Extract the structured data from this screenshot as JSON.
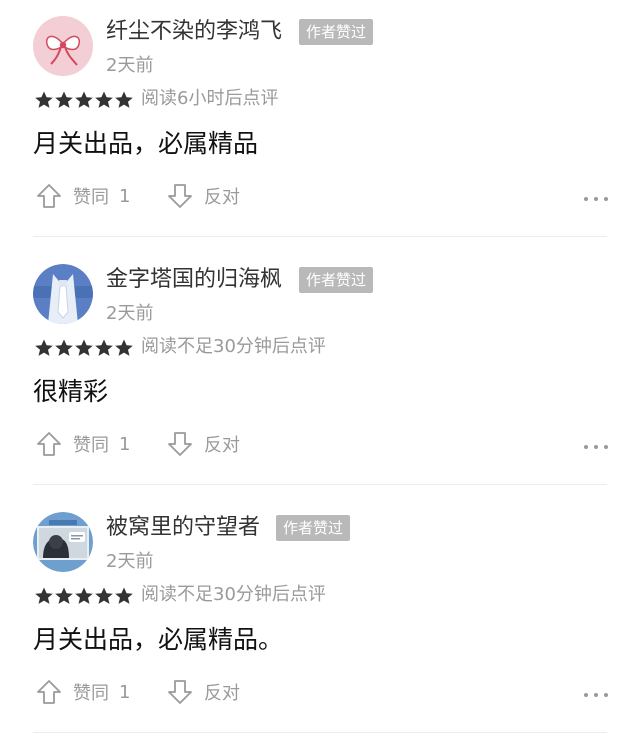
{
  "reviews": [
    {
      "username": "纤尘不染的李鸿飞",
      "badge": "作者赞过",
      "time": "2天前",
      "rating": 5,
      "reading_note": "阅读6小时后点评",
      "content": "月关出品，必属精品",
      "like_label": "赞同",
      "like_count": "1",
      "oppose_label": "反对",
      "avatar_icon": "pink-bow-avatar"
    },
    {
      "username": "金字塔国的归海枫",
      "badge": "作者赞过",
      "time": "2天前",
      "rating": 5,
      "reading_note": "阅读不足30分钟后点评",
      "content": "很精彩",
      "like_label": "赞同",
      "like_count": "1",
      "oppose_label": "反对",
      "avatar_icon": "blue-tie-avatar"
    },
    {
      "username": "被窝里的守望者",
      "badge": "作者赞过",
      "time": "2天前",
      "rating": 5,
      "reading_note": "阅读不足30分钟后点评",
      "content": "月关出品，必属精品。",
      "like_label": "赞同",
      "like_count": "1",
      "oppose_label": "反对",
      "avatar_icon": "comic-avatar"
    }
  ],
  "colors": {
    "muted_text": "#9a9a9a",
    "badge_bg": "#b9b9b9",
    "star": "#333333",
    "divider": "#ececec"
  }
}
